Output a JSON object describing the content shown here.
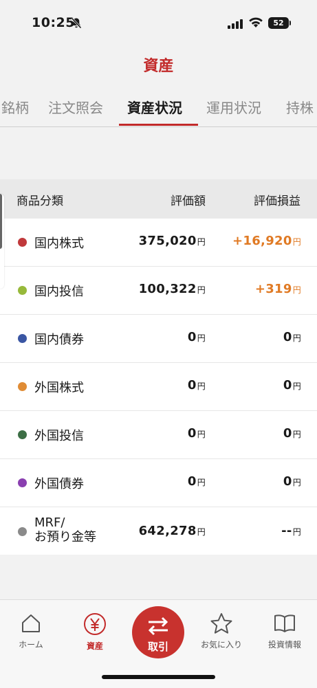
{
  "status": {
    "time": "10:25",
    "battery": "52"
  },
  "header": {
    "title": "資産"
  },
  "tabs": [
    "銘柄",
    "注文照会",
    "資産状況",
    "運用状況",
    "持株"
  ],
  "table": {
    "headers": {
      "category": "商品分類",
      "value": "評価額",
      "pl": "評価損益"
    },
    "yen": "円",
    "rows": [
      {
        "name": "国内株式",
        "color": "#c0393b",
        "value": "375,020",
        "pl": "+16,920",
        "positive": true
      },
      {
        "name": "国内投信",
        "color": "#97b93a",
        "value": "100,322",
        "pl": "+319",
        "positive": true
      },
      {
        "name": "国内債券",
        "color": "#3a56a3",
        "value": "0",
        "pl": "0",
        "positive": false
      },
      {
        "name": "外国株式",
        "color": "#e08c35",
        "value": "0",
        "pl": "0",
        "positive": false
      },
      {
        "name": "外国投信",
        "color": "#3c6e45",
        "value": "0",
        "pl": "0",
        "positive": false
      },
      {
        "name": "外国債券",
        "color": "#8a3fb0",
        "value": "0",
        "pl": "0",
        "positive": false
      },
      {
        "name_line1": "MRF/",
        "name_line2": "お預り金等",
        "color": "#8a8a8a",
        "value": "642,278",
        "pl": "--",
        "positive": false
      }
    ]
  },
  "nav": {
    "home": "ホーム",
    "assets": "資産",
    "trade": "取引",
    "favorites": "お気に入り",
    "info": "投資情報"
  },
  "colors": {
    "accent": "#c22a2a",
    "positive": "#e07a24"
  }
}
